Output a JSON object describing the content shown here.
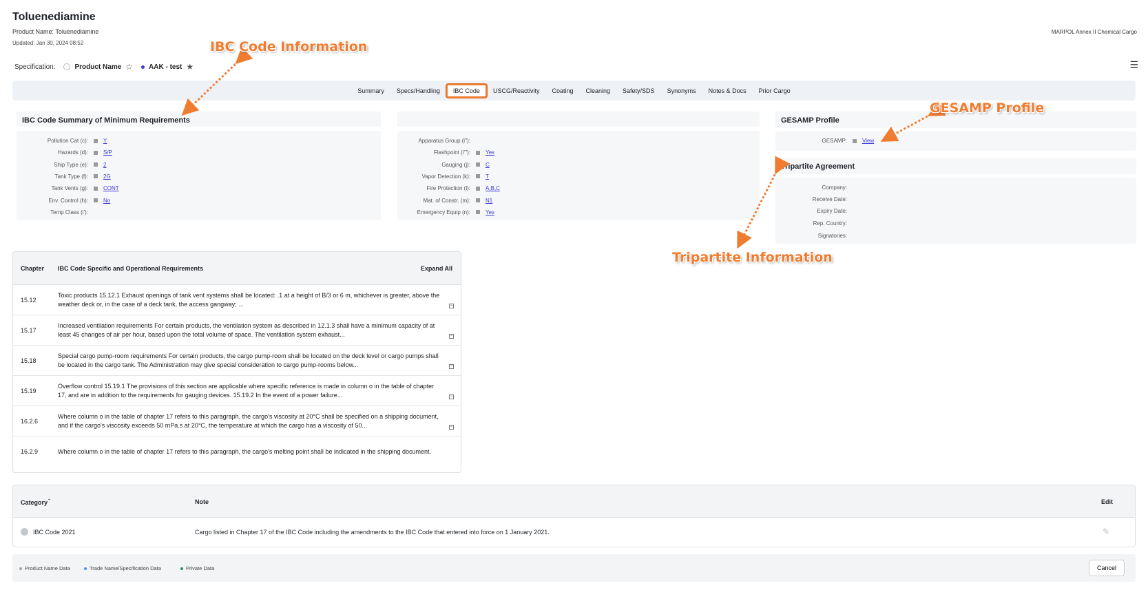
{
  "header": {
    "title": "Toluenediamine",
    "product_name": "Product Name: Toluenediamine",
    "updated": "Updated: Jan 30, 2024 08:52",
    "category_label": "MARPOL Annex II Chemical Cargo"
  },
  "specification": {
    "label": "Specification:",
    "option1": "Product Name",
    "option2": "AAK - test"
  },
  "tabs": [
    "Summary",
    "Specs/Handling",
    "IBC Code",
    "USCG/Reactivity",
    "Coating",
    "Cleaning",
    "Safety/SDS",
    "Synonyms",
    "Notes & Docs",
    "Prior Cargo"
  ],
  "active_tab": "IBC Code",
  "ibc_summary": {
    "title": "IBC Code Summary of Minimum Requirements",
    "left": [
      {
        "label": "Pollution Cat (c):",
        "value": "Y"
      },
      {
        "label": "Hazards (d):",
        "value": "S/P"
      },
      {
        "label": "Ship Type (e):",
        "value": "2"
      },
      {
        "label": "Tank Type (f):",
        "value": "2G"
      },
      {
        "label": "Tank Vents (g):",
        "value": "CONT"
      },
      {
        "label": "Env. Control (h):",
        "value": "No"
      },
      {
        "label": "Temp Class (i'):",
        "value": ""
      }
    ],
    "right": [
      {
        "label": "Apparatus Group (i''):",
        "value": ""
      },
      {
        "label": "Flashpoint (i'''):",
        "value": "Yes"
      },
      {
        "label": "Gauging (j):",
        "value": "C"
      },
      {
        "label": "Vapor Detection (k):",
        "value": "T"
      },
      {
        "label": "Fire Protection (l):",
        "value": "A,B,C"
      },
      {
        "label": "Mat. of Constr. (m):",
        "value": "N1"
      },
      {
        "label": "Emergency Equip (n):",
        "value": "Yes"
      }
    ]
  },
  "gesamp": {
    "title": "GESAMP Profile",
    "label": "GESAMP:",
    "value": "View"
  },
  "tripartite": {
    "title": "Tripartite Agreement",
    "fields": [
      "Company:",
      "Receive Date:",
      "Expiry Date:",
      "Rep. Country:",
      "Signatories:"
    ]
  },
  "requirements": {
    "col_chapter": "Chapter",
    "col_req": "IBC Code Specific and Operational Requirements",
    "expand_all": "Expand All",
    "rows": [
      {
        "chapter": "15.12",
        "text": "Toxic products 15.12.1 Exhaust openings of tank vent systems shall be located: .1 at a height of B/3 or 6 m, whichever is greater, above the weather deck or, in the case of a deck tank, the access gangway; ..."
      },
      {
        "chapter": "15.17",
        "text": "Increased ventilation requirements For certain products, the ventilation system as described in 12.1.3 shall have a minimum capacity of at least 45 changes of air per hour, based upon the total volume of space. The ventilation system exhaust..."
      },
      {
        "chapter": "15.18",
        "text": "Special cargo pump-room requirements For certain products, the cargo pump-room shall be located on the deck level or cargo pumps shall be located in the cargo tank. The Administration may give special consideration to cargo pump-rooms below..."
      },
      {
        "chapter": "15.19",
        "text": "Overflow control 15.19.1 The provisions of this section are applicable where specific reference is made in column o in the table of chapter 17, and are in addition to the requirements for gauging devices. 15.19.2 In the event of a power failure..."
      },
      {
        "chapter": "16.2.6",
        "text": "Where column o in the table of chapter 17 refers to this paragraph, the cargo's viscosity at 20°C shall be specified on a shipping document, and if the cargo's viscosity exceeds 50 mPa.s at 20°C, the temperature at which the cargo has a viscosity of 50..."
      },
      {
        "chapter": "16.2.9",
        "text": "Where column o in the table of chapter 17 refers to this paragraph, the cargo's melting point shall be indicated in the shipping document."
      }
    ]
  },
  "notes": {
    "col_category": "Category",
    "col_note": "Note",
    "col_edit": "Edit",
    "rows": [
      {
        "category": "IBC Code 2021",
        "note": "Cargo listed in Chapter 17 of the IBC Code including the amendments to the IBC Code that entered into force on 1 January 2021."
      }
    ]
  },
  "legend": {
    "product_name": "Product Name Data",
    "trade_name": "Trade Name/Specification Data",
    "private": "Private Data"
  },
  "cancel_label": "Cancel",
  "callouts": {
    "ibc": "IBC Code Information",
    "gesamp": "GESAMP Profile",
    "tripartite": "Tripartite Information"
  },
  "colors": {
    "accent": "#f07c30",
    "link": "#3b3bd6",
    "product_dot": "#9aa3b0",
    "trade_dot": "#5b8def",
    "private_dot": "#2e8b57"
  }
}
